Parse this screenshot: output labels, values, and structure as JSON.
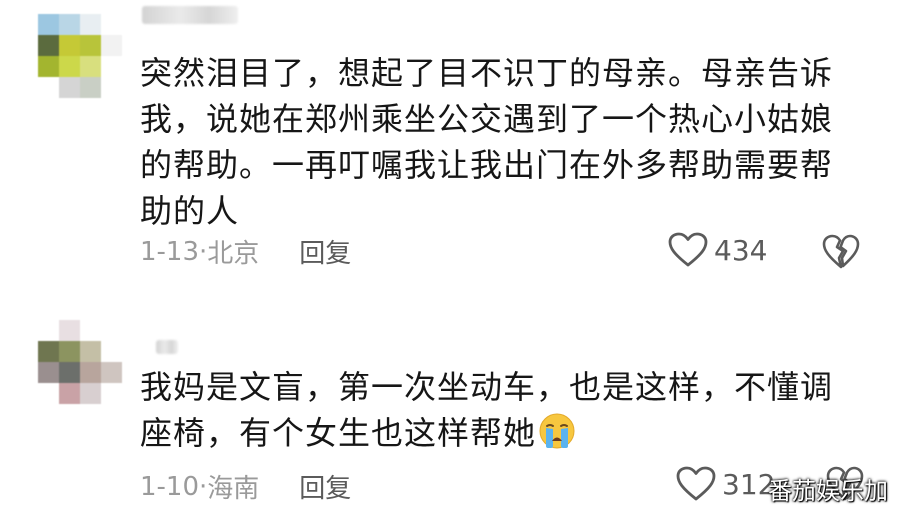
{
  "comments": [
    {
      "text": "突然泪目了，想起了目不识丁的母亲。母亲告诉我，说她在郑州乘坐公交遇到了一个热心小姑娘的帮助。一再叮嘱我让我出门在外多帮助需要帮助的人",
      "date": "1-13",
      "location": "北京",
      "reply_label": "回复",
      "likes": "434",
      "avatar_colors": [
        "#9cc7e1",
        "#b9d6e6",
        "#e8eef2",
        "#ffffff",
        "#5b6b3e",
        "#c5c936",
        "#b8c43a",
        "#f2f2f2",
        "#a3b52f",
        "#ccd84a",
        "#d8df7e",
        "#ffffff",
        "#ffffff",
        "#d5d5d5",
        "#c9cfc5",
        "#ffffff"
      ]
    },
    {
      "text": "我妈是文盲，第一次坐动车，也是这样，不懂调座椅，有个女生也这样帮她",
      "emoji": "crying-face",
      "date": "1-10",
      "location": "海南",
      "reply_label": "回复",
      "likes": "312",
      "avatar_colors": [
        "#ffffff",
        "#e8dfe2",
        "#ffffff",
        "#ffffff",
        "#6f7650",
        "#8c9460",
        "#c4bfa6",
        "#ffffff",
        "#9a8f8f",
        "#6c6f6b",
        "#b8a59d",
        "#cfc5c0",
        "#ffffff",
        "#c9a2a6",
        "#d8cfd0",
        "#ffffff"
      ]
    }
  ],
  "watermark": "番茄娱乐加",
  "colors": {
    "text": "#161616",
    "meta": "#9a9a9a",
    "icon": "#5b5b5b"
  }
}
